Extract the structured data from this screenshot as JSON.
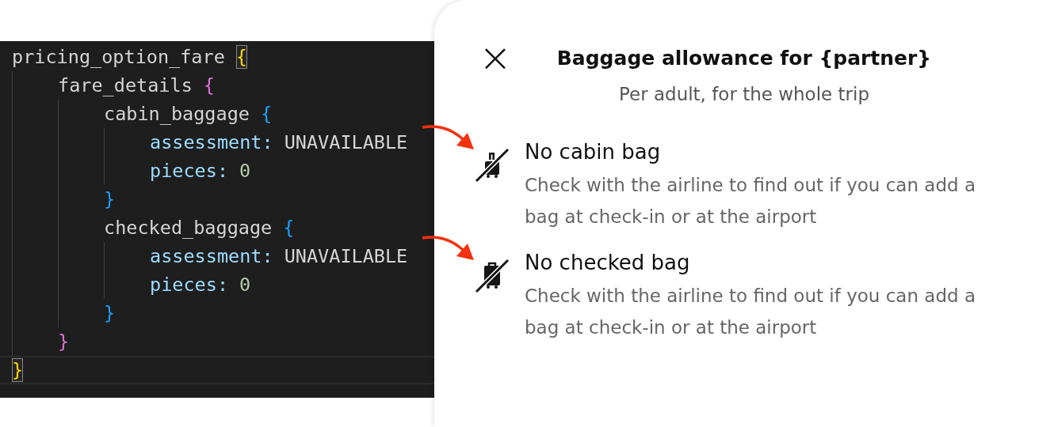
{
  "editor": {
    "blocks": [
      {
        "key": "pricing_option_fare",
        "open": "{",
        "close": "}",
        "bracket_match": true,
        "children": [
          {
            "key": "fare_details",
            "open": "{",
            "close": "}",
            "bracket_match": false,
            "children": [
              {
                "key": "cabin_baggage",
                "open": "{",
                "close": "}",
                "bracket_match": false,
                "children": [
                  {
                    "key": "assessment",
                    "sep": ":",
                    "value": "UNAVAILABLE",
                    "kind": "enum"
                  },
                  {
                    "key": "pieces",
                    "sep": ":",
                    "value": "0",
                    "kind": "number"
                  }
                ]
              },
              {
                "key": "checked_baggage",
                "open": "{",
                "close": "}",
                "bracket_match": false,
                "children": [
                  {
                    "key": "assessment",
                    "sep": ":",
                    "value": "UNAVAILABLE",
                    "kind": "enum"
                  },
                  {
                    "key": "pieces",
                    "sep": ":",
                    "value": "0",
                    "kind": "number"
                  }
                ]
              }
            ]
          }
        ],
        "close_line_current": true
      }
    ]
  },
  "modal": {
    "close": "×",
    "title": "Baggage allowance for {partner}",
    "subtitle": "Per adult, for the whole trip",
    "items": [
      {
        "kind": "cabin",
        "title": "No cabin bag",
        "description": "Check with the airline to find out if you can add a bag at check-in or at the airport",
        "arrow": true
      },
      {
        "kind": "checked",
        "title": "No checked bag",
        "description": "Check with the airline to find out if you can add a bag at check-in or at the airport",
        "arrow": true
      }
    ]
  }
}
